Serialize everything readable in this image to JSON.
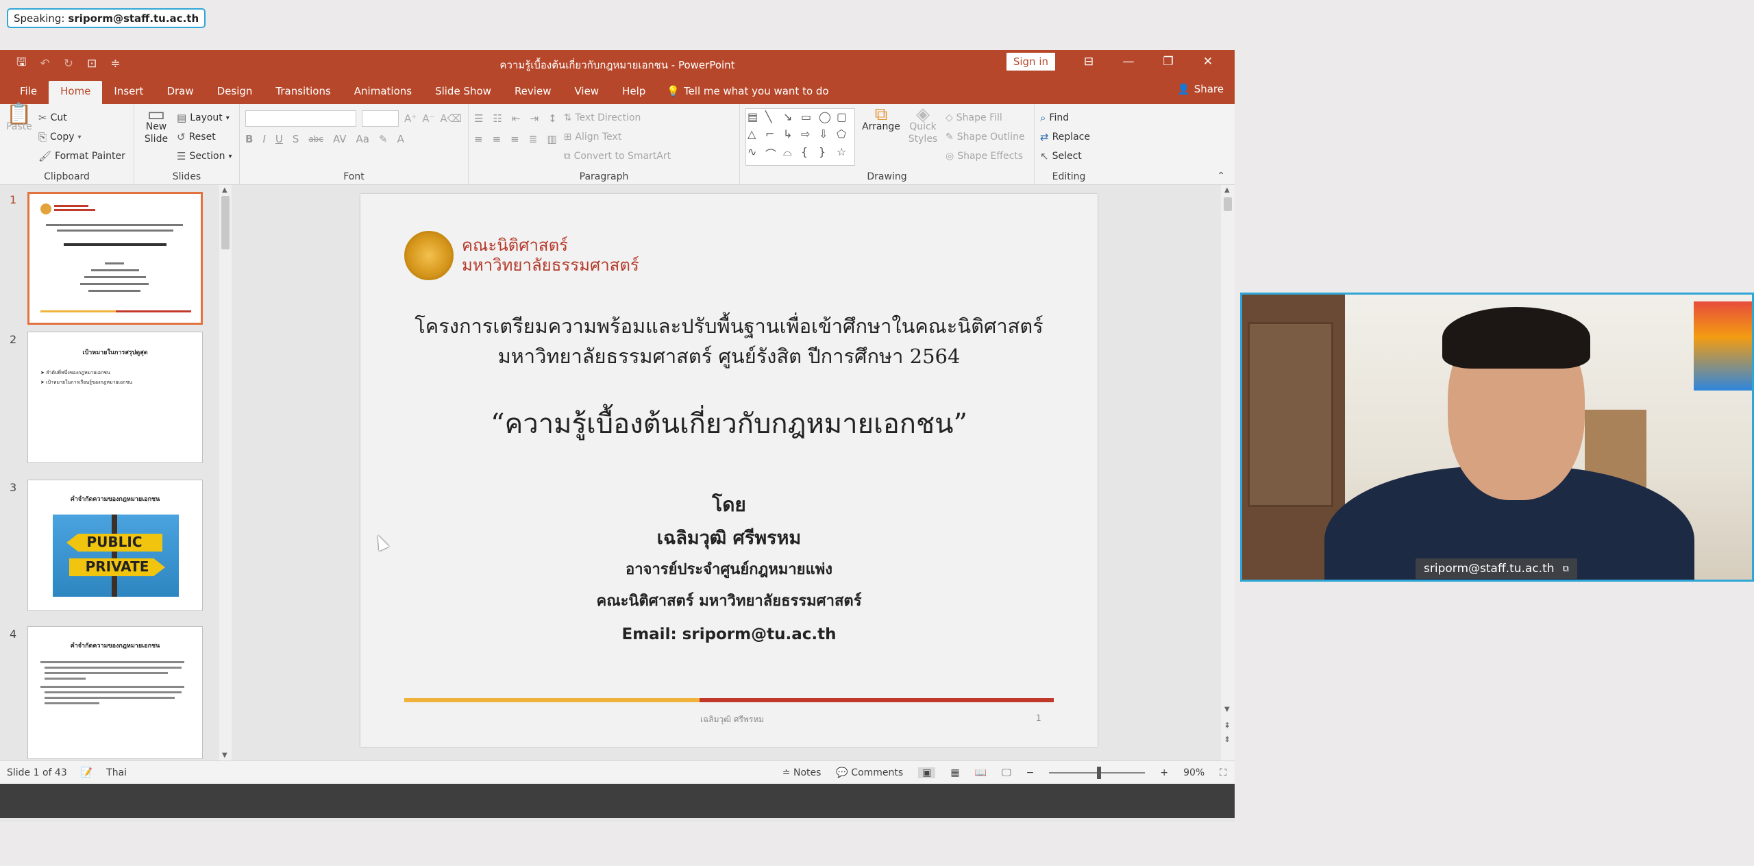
{
  "speaking": {
    "prefix": "Speaking:",
    "name": "sriporm@staff.tu.ac.th"
  },
  "window": {
    "title": "ความรู้เบื้องต้นเกี่ยวกับกฎหมายเอกชน - PowerPoint",
    "sign_in": "Sign in",
    "share": "Share"
  },
  "tabs": [
    "File",
    "Home",
    "Insert",
    "Draw",
    "Design",
    "Transitions",
    "Animations",
    "Slide Show",
    "Review",
    "View",
    "Help"
  ],
  "tell_me": "Tell me what you want to do",
  "ribbon": {
    "clipboard": {
      "label": "Clipboard",
      "paste": "Paste",
      "cut": "Cut",
      "copy": "Copy",
      "format_painter": "Format Painter"
    },
    "slides": {
      "label": "Slides",
      "new_slide_1": "New",
      "new_slide_2": "Slide",
      "layout": "Layout",
      "reset": "Reset",
      "section": "Section"
    },
    "font": {
      "label": "Font"
    },
    "paragraph": {
      "label": "Paragraph",
      "text_direction": "Text Direction",
      "align_text": "Align Text",
      "convert_smartart": "Convert to SmartArt"
    },
    "drawing": {
      "label": "Drawing",
      "arrange": "Arrange",
      "quick_styles_1": "Quick",
      "quick_styles_2": "Styles",
      "shape_fill": "Shape Fill",
      "shape_outline": "Shape Outline",
      "shape_effects": "Shape Effects"
    },
    "editing": {
      "label": "Editing",
      "find": "Find",
      "replace": "Replace",
      "select": "Select"
    }
  },
  "thumbnails": [
    {
      "num": "1",
      "active": true
    },
    {
      "num": "2",
      "title": "เป้าหมายในการสรุปดูสุด",
      "lines": [
        "ลำดับที่หนึ่งของกฎหมายเอกชน",
        "เป้าหมายในการเรียนรู้ของกฎหมายเอกชน"
      ]
    },
    {
      "num": "3",
      "title": "คำจำกัดความของกฎหมายเอกชน",
      "sign_top": "PUBLIC",
      "sign_bottom": "PRIVATE"
    },
    {
      "num": "4",
      "title": "คำจำกัดความของกฎหมายเอกชน"
    }
  ],
  "slide": {
    "logo_line1": "คณะนิติศาสตร์",
    "logo_line2": "มหาวิทยาลัยธรรมศาสตร์",
    "heading1": "โครงการเตรียมความพร้อมและปรับพื้นฐานเพื่อเข้าศึกษาในคณะนิติศาสตร์",
    "heading2": "มหาวิทยาลัยธรรมศาสตร์ ศูนย์รังสิต ปีการศึกษา 2564",
    "title": "“ความรู้เบื้องต้นเกี่ยวกับกฎหมายเอกชน”",
    "by": "โดย",
    "author": "เฉลิมวุฒิ ศรีพรหม",
    "position": "อาจารย์ประจำศูนย์กฎหมายแพ่ง",
    "faculty": "คณะนิติศาสตร์ มหาวิทยาลัยธรรมศาสตร์",
    "email": "Email: sriporm@tu.ac.th",
    "footer_author": "เฉลิมวุฒิ ศรีพรหม",
    "page": "1"
  },
  "status": {
    "slide_info": "Slide 1 of 43",
    "language": "Thai",
    "notes": "Notes",
    "comments": "Comments",
    "zoom": "90%"
  },
  "webcam": {
    "label": "sriporm@staff.tu.ac.th"
  },
  "colors": {
    "accent": "#b7472a",
    "speaking_border": "#2fa7d6",
    "status_dark": "#3e3e3e"
  }
}
